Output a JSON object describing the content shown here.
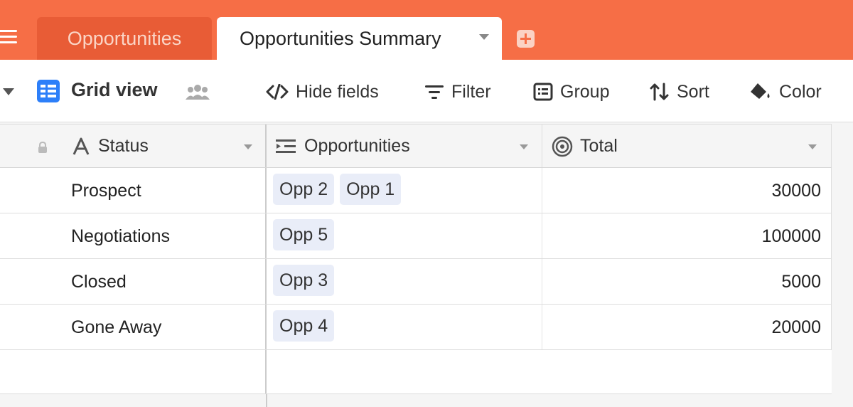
{
  "tabs": [
    {
      "label": "Opportunities",
      "active": false
    },
    {
      "label": "Opportunities Summary",
      "active": true
    }
  ],
  "toolbar": {
    "view_name": "Grid view",
    "hide_fields": "Hide fields",
    "filter": "Filter",
    "group": "Group",
    "sort": "Sort",
    "color": "Color"
  },
  "columns": [
    {
      "label": "Status",
      "icon": "text-field-icon"
    },
    {
      "label": "Opportunities",
      "icon": "linked-record-icon"
    },
    {
      "label": "Total",
      "icon": "rollup-icon"
    }
  ],
  "rows": [
    {
      "status": "Prospect",
      "opportunities": [
        "Opp 2",
        "Opp 1"
      ],
      "total": "30000"
    },
    {
      "status": "Negotiations",
      "opportunities": [
        "Opp 5"
      ],
      "total": "100000"
    },
    {
      "status": "Closed",
      "opportunities": [
        "Opp 3"
      ],
      "total": "5000"
    },
    {
      "status": "Gone Away",
      "opportunities": [
        "Opp 4"
      ],
      "total": "20000"
    }
  ],
  "colors": {
    "accent": "#f66e46",
    "grid_icon": "#2d7ff9",
    "chip": "#e9edf8"
  }
}
